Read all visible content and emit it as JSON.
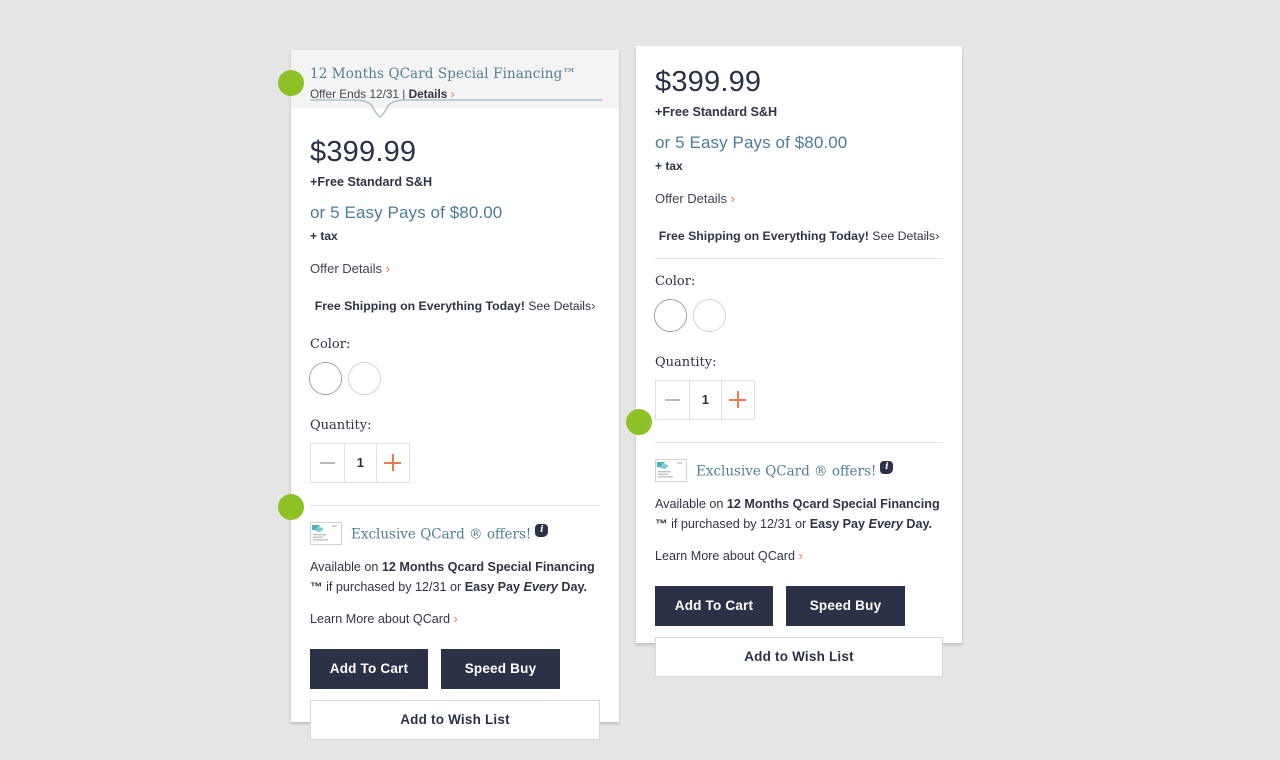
{
  "financing_banner": {
    "title": "12 Months QCard Special Financing™",
    "offer_ends": "Offer Ends 12/31 | ",
    "details_label": "Details",
    "chevron": "›"
  },
  "pricing": {
    "price": "$399.99",
    "shipping_note": "+Free Standard S&H",
    "easy_pay": "or 5 Easy Pays of $80.00",
    "tax_note": "+ tax",
    "offer_details_label": "Offer Details",
    "chevron": "›"
  },
  "promo": {
    "bold_text": "Free Shipping on Everything Today!",
    "link_text": " See Details",
    "chevron": "›"
  },
  "color_section": {
    "label": "Color:",
    "swatches": [
      {
        "name": "gray-magenta",
        "top": "#7c7a80",
        "bottom": "#a93289",
        "selected": true
      },
      {
        "name": "white-gray",
        "top": "#ededed",
        "bottom": "#8d8f92",
        "selected": false
      }
    ]
  },
  "quantity_section": {
    "label": "Quantity:",
    "value": "1",
    "minus_label": "−",
    "plus_label": "+"
  },
  "qcard": {
    "title": "Exclusive QCard ® offers!",
    "info_label": "i",
    "body_prefix": "Available on ",
    "body_bold1": "12 Months Qcard Special Financing ™",
    "body_mid": " if purchased by 12/31 or ",
    "body_bold2": "Easy Pay ",
    "body_italic": "Every",
    "body_bold3": " Day.",
    "learn_more_label": "Learn More about QCard",
    "chevron": "›"
  },
  "actions": {
    "add_to_cart": "Add To Cart",
    "speed_buy": "Speed Buy",
    "add_to_wish_list": "Add to Wish List"
  },
  "annotations": {
    "marker_color": "#8cc225",
    "markers": [
      {
        "name": "financing-banner-marker"
      },
      {
        "name": "qcard-offers-marker-left"
      },
      {
        "name": "qcard-offers-marker-right"
      }
    ]
  },
  "theme": {
    "navy": "#2b3147",
    "steel_blue": "#4f7f96",
    "orange": "#e8734a",
    "page_background": "#e5e5e5"
  }
}
